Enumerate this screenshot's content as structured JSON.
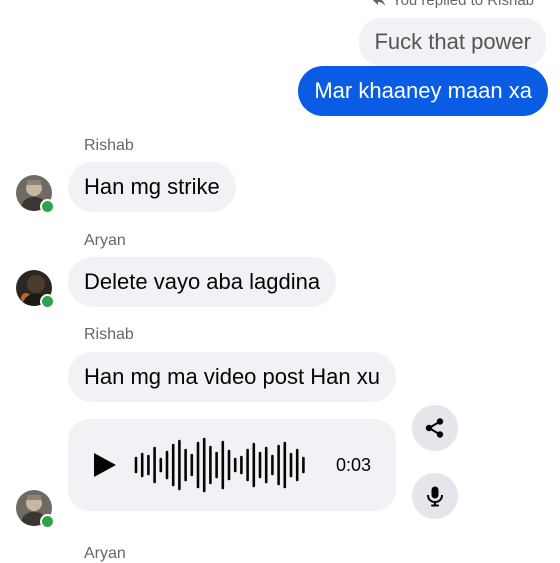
{
  "reply_note": "You replied to Rishab",
  "quoted_message": "Fuck that power",
  "outgoing_message": "Mar khaaney maan xa",
  "messages": [
    {
      "sender": "Rishab",
      "text": "Han mg strike"
    },
    {
      "sender": "Aryan",
      "text": "Delete vayo aba lagdina"
    },
    {
      "sender": "Rishab",
      "text": "Han mg ma video post Han xu"
    }
  ],
  "voice_message": {
    "duration": "0:03",
    "play_icon": "play-icon"
  },
  "next_sender": "Aryan",
  "icons": {
    "share": "share-icon",
    "mic": "microphone-icon",
    "reply": "reply-arrow-icon"
  },
  "colors": {
    "outgoing_bubble": "#0a5ce5",
    "incoming_bubble": "#f0f2f5",
    "online_dot": "#31a24c",
    "action_button": "#e4e6eb"
  }
}
